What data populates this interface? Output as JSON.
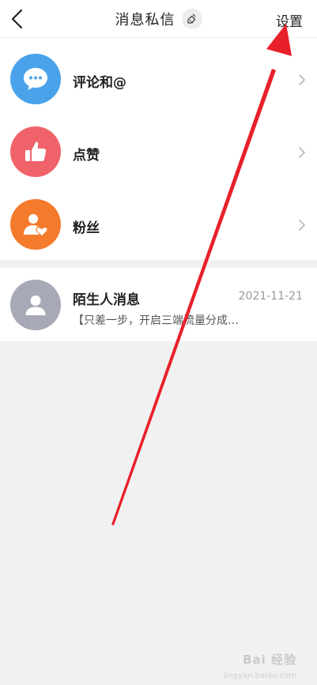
{
  "header": {
    "title": "消息私信",
    "settings_label": "设置",
    "back_icon": "chevron-left-icon",
    "clear_icon": "broom-icon"
  },
  "rows": [
    {
      "label": "评论和@",
      "icon": "chat-bubble-icon",
      "color": "#4aa3ea"
    },
    {
      "label": "点赞",
      "icon": "thumbs-up-icon",
      "color": "#f0636a"
    },
    {
      "label": "粉丝",
      "icon": "person-heart-icon",
      "color": "#f47a2c"
    }
  ],
  "stranger": {
    "title": "陌生人消息",
    "date": "2021-11-21",
    "preview": "【只差一步，开启三端流量分成…",
    "icon": "person-icon",
    "color": "#a7a9b6"
  },
  "watermark": {
    "text": "Bai 经验",
    "sub": "jingyan.baidu.com"
  },
  "annotation": {
    "color": "#e8202a"
  }
}
